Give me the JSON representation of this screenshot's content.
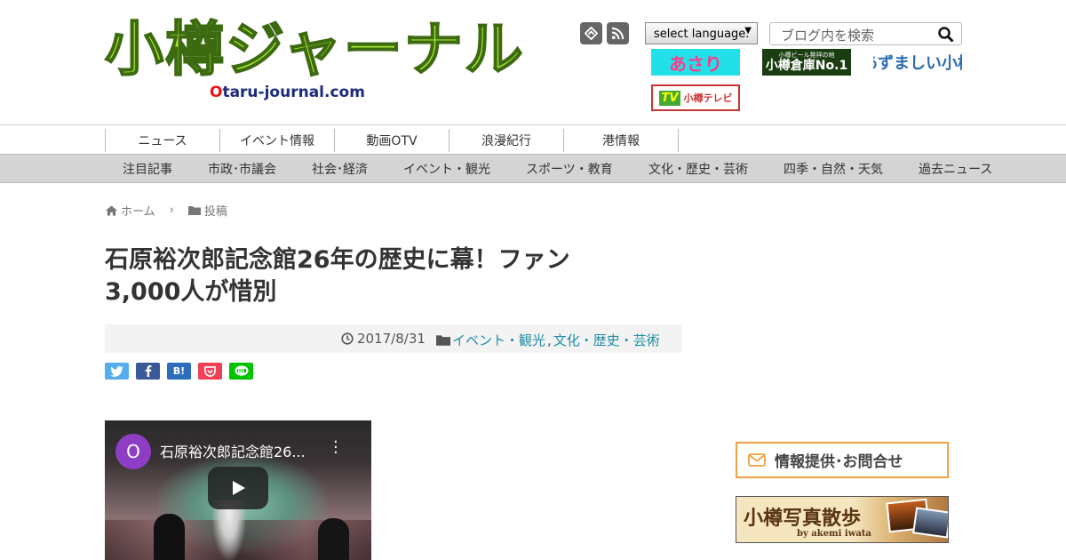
{
  "header": {
    "logo_title": "小樽ジャーナル",
    "logo_domain_o": "O",
    "logo_domain_rest": "taru-journal",
    "logo_domain_tld": ".com",
    "language_select": "select language.",
    "search_placeholder": "ブログ内を検索",
    "banners": {
      "asari": "あさり",
      "soko_small": "小樽ビール発祥の地",
      "soko_big": "小樽倉庫No.1",
      "azuma": "あずましい小樽",
      "otv_tv": "TV",
      "otv_label": "小樽テレビ"
    }
  },
  "nav_primary": [
    "ニュース",
    "イベント情報",
    "動画OTV",
    "浪漫紀行",
    "港情報"
  ],
  "nav_secondary": [
    "注目記事",
    "市政･市議会",
    "社会･経済",
    "イベント・観光",
    "スポーツ・教育",
    "文化・歴史・芸術",
    "四季・自然・天気",
    "過去ニュース"
  ],
  "breadcrumb": {
    "home": "ホーム",
    "category": "投稿"
  },
  "article": {
    "title_line1": "石原裕次郎記念館26年の歴史に幕！ファン",
    "title_line2": "3,000人が惜別",
    "date": "2017/8/31",
    "cat1": "イベント・観光",
    "sep": ",",
    "cat2": "文化・歴史・芸術"
  },
  "share": {
    "hatena": "B!"
  },
  "video": {
    "avatar": "O",
    "title": "石原裕次郎記念館26..."
  },
  "sidebar": {
    "contact": "情報提供･お問合せ",
    "photo_title": "小樽写真散歩",
    "photo_sub": "by akemi iwata"
  },
  "colors": {
    "accent_link": "#1e8ca6",
    "logo_green": "#a6e22e",
    "nav_bg": "#d4d4d4"
  }
}
